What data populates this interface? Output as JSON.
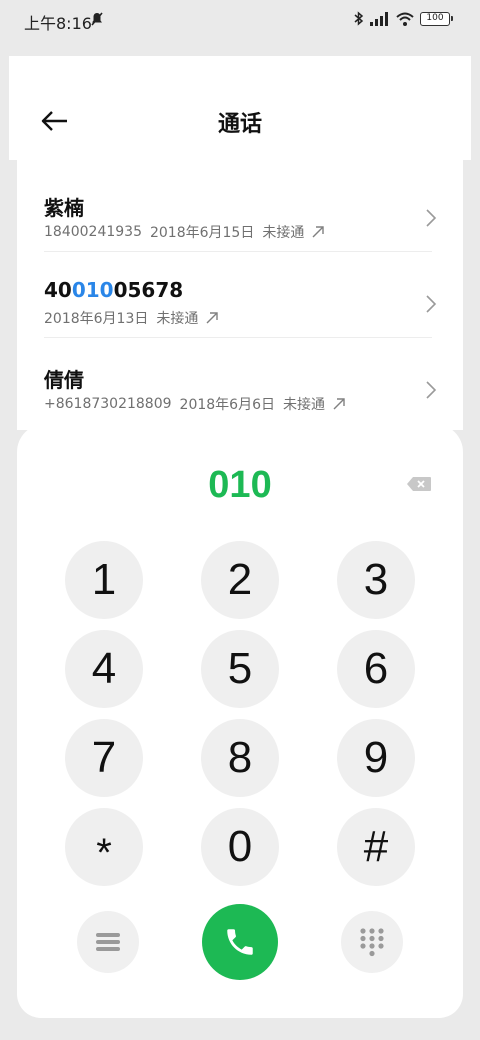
{
  "status_bar": {
    "time": "上午8:16",
    "battery": "100"
  },
  "header": {
    "title": "通话"
  },
  "calls": [
    {
      "name": "紫楠",
      "number": "18400241935",
      "date": "2018年6月15日",
      "status": "未接通"
    },
    {
      "name_prefix": "40",
      "name_match": "010",
      "name_suffix": "05678",
      "date": "2018年6月13日",
      "status": "未接通"
    },
    {
      "name": "倩倩",
      "number": "+8618730218809",
      "date": "2018年6月6日",
      "status": "未接通"
    }
  ],
  "dialer": {
    "input": "010",
    "keys": [
      "1",
      "2",
      "3",
      "4",
      "5",
      "6",
      "7",
      "8",
      "9",
      "*",
      "0",
      "#"
    ]
  },
  "colors": {
    "accent_green": "#1db954",
    "match_blue": "#2a86e8"
  },
  "icons": [
    "back-arrow-icon",
    "chevron-right-icon",
    "outgoing-call-icon",
    "backspace-icon",
    "menu-icon",
    "phone-icon",
    "keypad-icon",
    "bluetooth-icon",
    "signal-icon",
    "wifi-icon",
    "battery-icon",
    "mute-icon"
  ]
}
